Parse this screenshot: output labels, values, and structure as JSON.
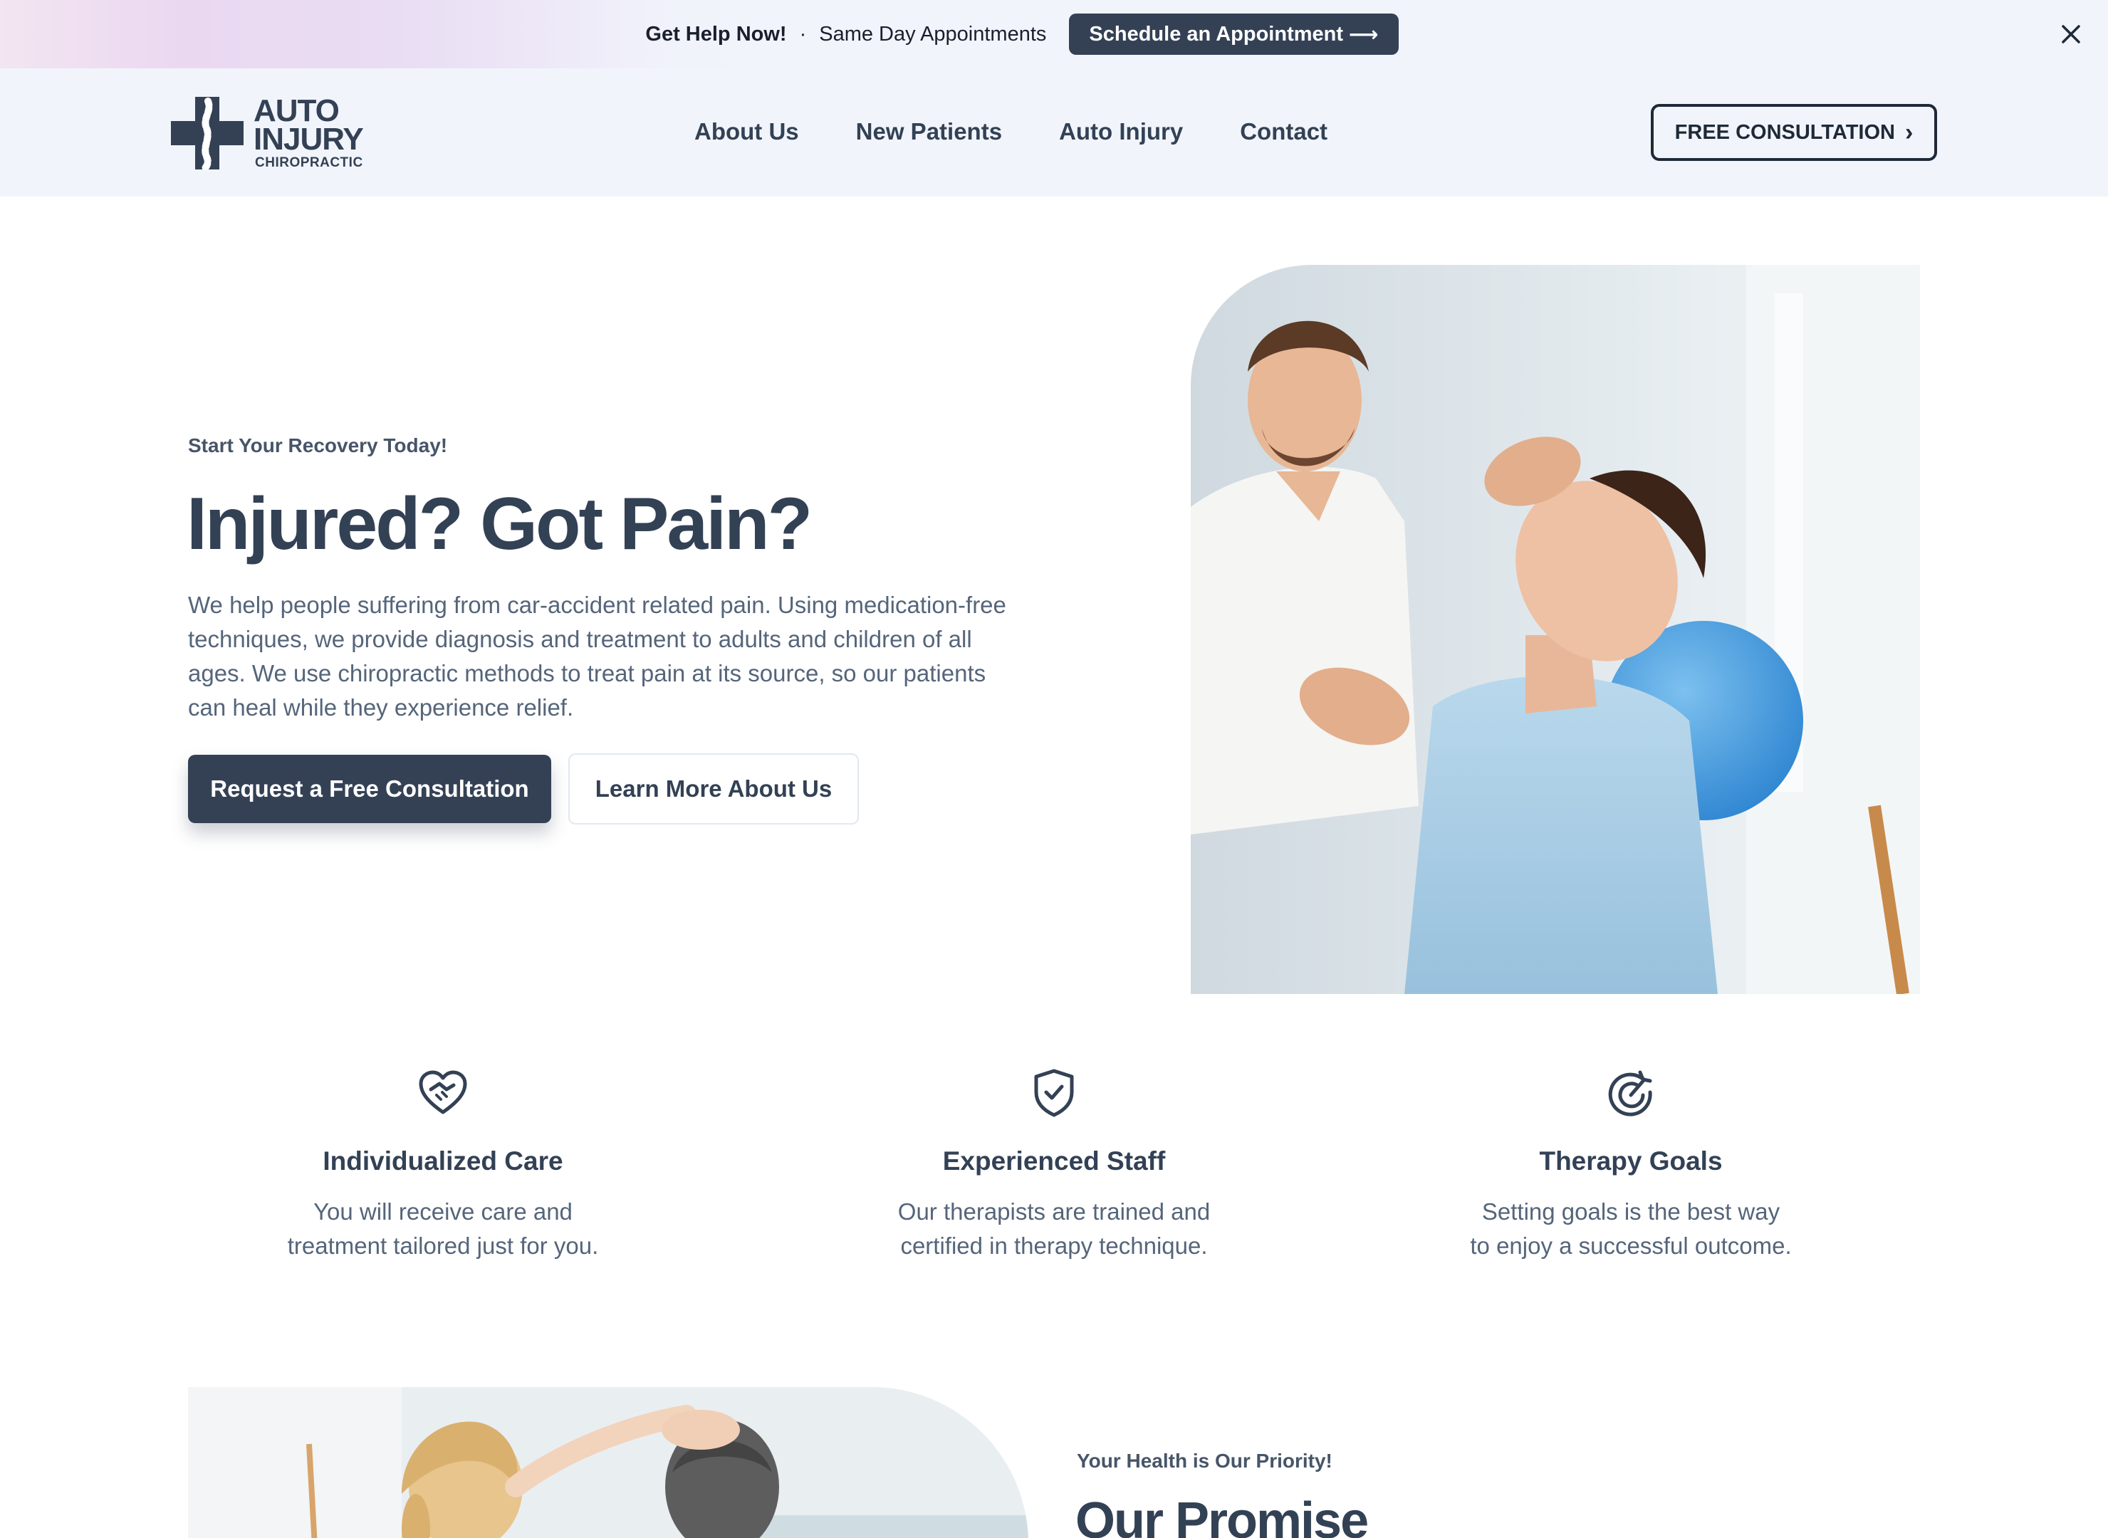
{
  "banner": {
    "highlight": "Get Help Now!",
    "separator": "·",
    "text": "Same Day Appointments",
    "button_label": "Schedule an Appointment",
    "button_arrow": "⟶"
  },
  "header": {
    "logo": {
      "line1": "AUTO",
      "line2": "INJURY",
      "line3": "CHIROPRACTIC"
    },
    "nav": [
      "About Us",
      "New Patients",
      "Auto Injury",
      "Contact"
    ],
    "cta_label": "FREE CONSULTATION",
    "cta_chevron": "›"
  },
  "hero": {
    "eyebrow": "Start Your Recovery Today!",
    "title": "Injured? Got Pain?",
    "description": "We help people suffering from car-accident related pain. Using medication-free techniques, we provide diagnosis and treatment to adults and children of all ages. We use chiropractic methods to treat pain at its source, so our patients can heal while they experience relief.",
    "primary_button": "Request a Free Consultation",
    "secondary_button": "Learn More About Us"
  },
  "features": [
    {
      "icon": "heart-handshake-icon",
      "title": "Individualized Care",
      "line1": "You will receive care and",
      "line2": "treatment tailored just for you."
    },
    {
      "icon": "shield-check-icon",
      "title": "Experienced Staff",
      "line1": "Our therapists are trained and",
      "line2": "certified in therapy technique."
    },
    {
      "icon": "target-arrow-icon",
      "title": "Therapy Goals",
      "line1": "Setting goals is the best way",
      "line2": "to enjoy a successful outcome."
    }
  ],
  "promise": {
    "eyebrow": "Your Health is Our Priority!",
    "title": "Our Promise"
  },
  "colors": {
    "primary": "#344155",
    "text": "#334155",
    "muted": "#55657a",
    "header_bg": "#f1f5fb"
  }
}
